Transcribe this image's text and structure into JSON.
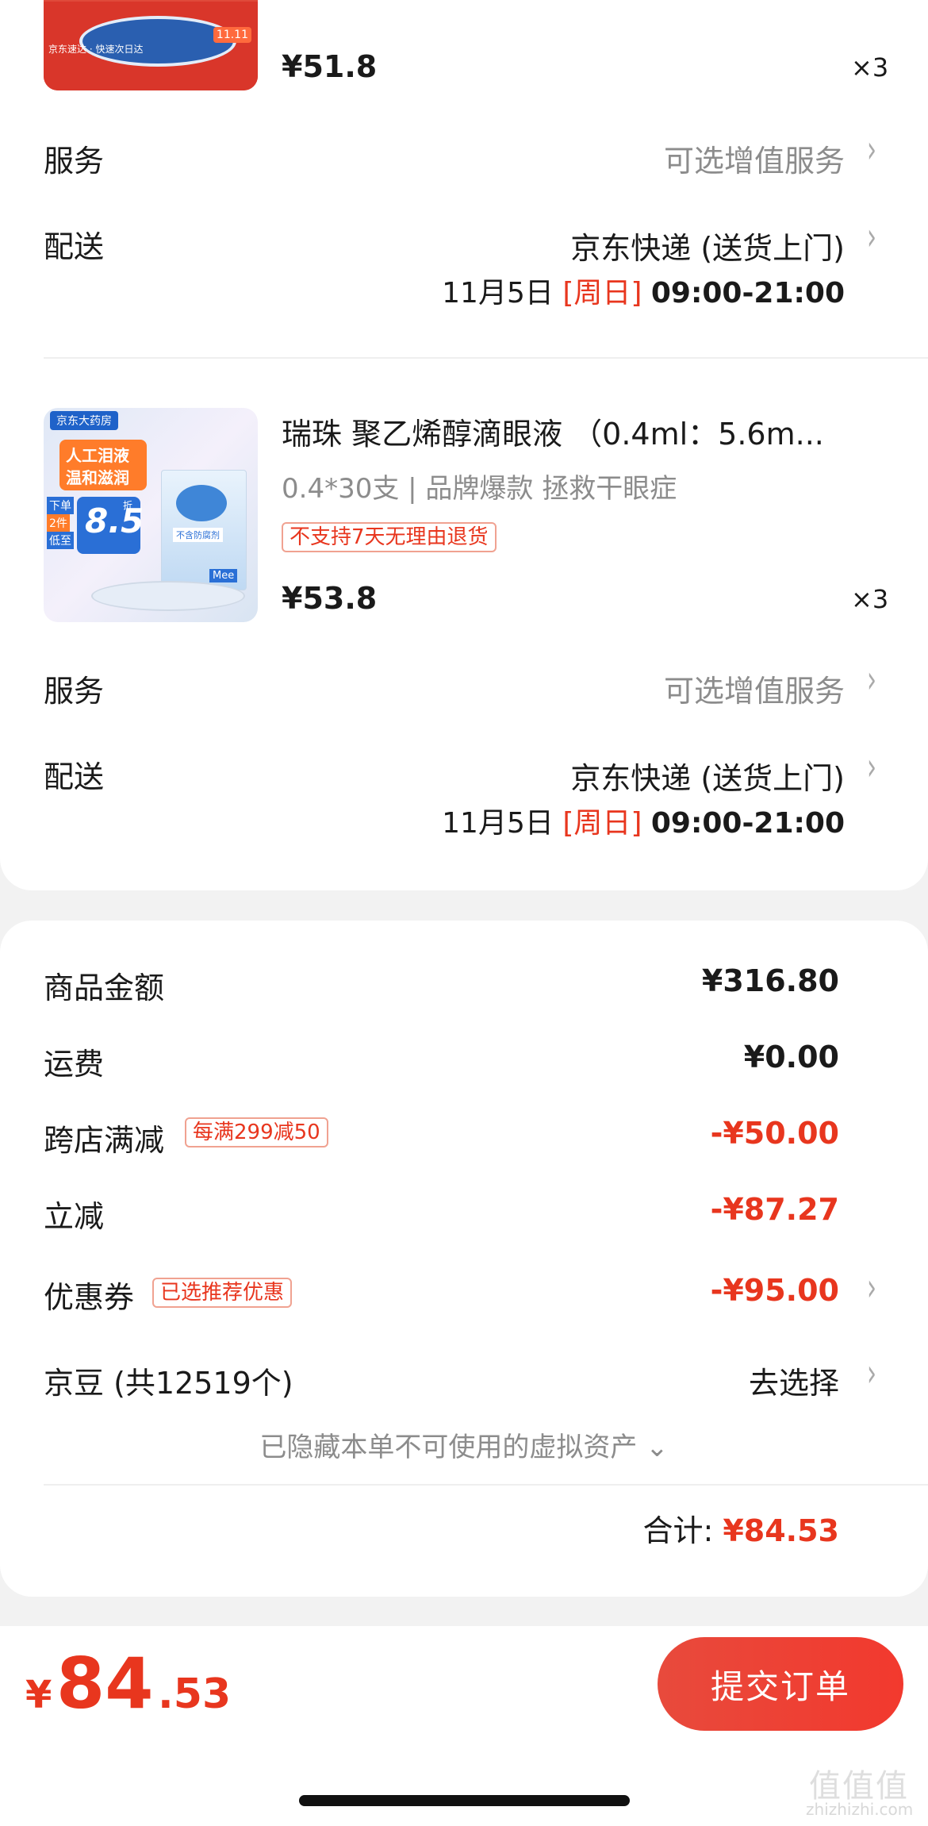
{
  "product1": {
    "price": "¥51.8",
    "qty": "×3",
    "thumb_badge": "11.11",
    "thumb_footer": "京东速达 · 快速次日达"
  },
  "service_row_label": "服务",
  "service_row_value": "可选增值服务",
  "delivery_row_label": "配送",
  "delivery_method": "京东快递 (送货上门)",
  "delivery_date": "11月5日",
  "delivery_weekday": "[周日]",
  "delivery_time": "09:00-21:00",
  "product2": {
    "title": "瑞珠 聚乙烯醇滴眼液 （0.4ml：5.6m...",
    "subtitle": "0.4*30支 | 品牌爆款 拯救干眼症",
    "tag": "不支持7天无理由退货",
    "price": "¥53.8",
    "qty": "×3",
    "thumb": {
      "store": "京东大药房",
      "banner1": "人工泪液",
      "banner2": "温和滋润",
      "promo_a": "下单",
      "promo_b": "2件",
      "promo_c": "低至",
      "promo_price": "8.5",
      "promo_tag": "折",
      "box_label": "不含防腐剂",
      "brand": "Mee"
    }
  },
  "summary": {
    "goods_label": "商品金额",
    "goods_value": "¥316.80",
    "shipping_label": "运费",
    "shipping_value": "¥0.00",
    "cross_label": "跨店满减",
    "cross_tag": "每满299减50",
    "cross_value": "-¥50.00",
    "instant_label": "立减",
    "instant_value": "-¥87.27",
    "coupon_label": "优惠券",
    "coupon_tag": "已选推荐优惠",
    "coupon_value": "-¥95.00",
    "jd_bean_label": "京豆 (共12519个)",
    "jd_bean_value": "去选择",
    "hidden_note": "已隐藏本单不可使用的虚拟资产 ⌄",
    "total_label": "合计:",
    "total_value": "¥84.53"
  },
  "footer": {
    "currency": "¥",
    "amount_int": "84",
    "amount_dec": ".53",
    "submit_label": "提交订单"
  },
  "watermark": {
    "logo": "值值值",
    "domain": "zhizhizhi.com"
  },
  "colors": {
    "accent": "#e8361e",
    "button": "#f2392e"
  }
}
